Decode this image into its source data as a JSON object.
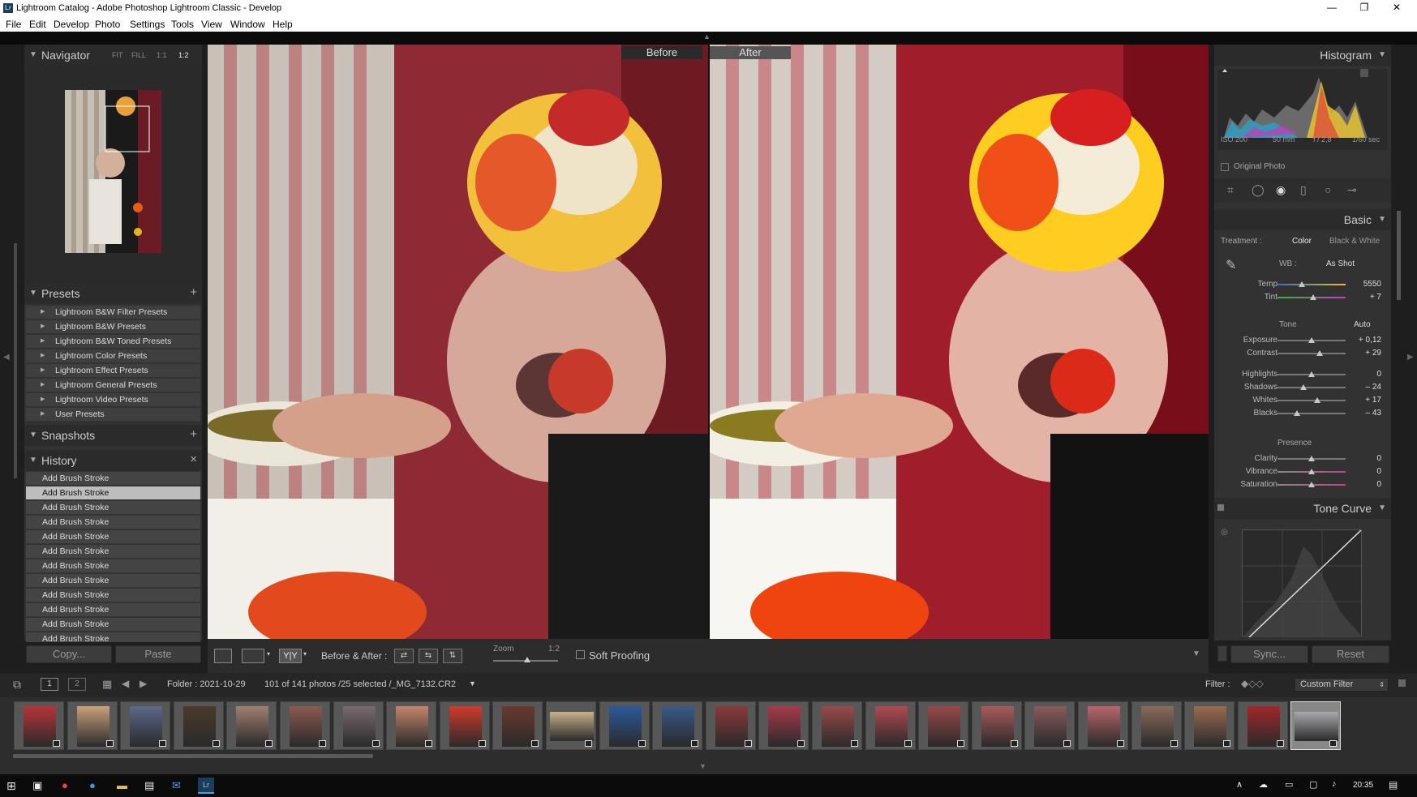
{
  "window": {
    "title": "Lightroom Catalog - Adobe Photoshop Lightroom Classic - Develop",
    "app_icon": "Lr",
    "controls": [
      "—",
      "❐",
      "✕"
    ]
  },
  "menu": [
    "File",
    "Edit",
    "Develop",
    "Photo",
    "Settings",
    "Tools",
    "View",
    "Window",
    "Help"
  ],
  "navigator": {
    "title": "Navigator",
    "options": [
      "FIT",
      "FILL",
      "1:1",
      "1:2"
    ],
    "selected": "1:2"
  },
  "presets": {
    "title": "Presets",
    "add": "+",
    "items": [
      "Lightroom B&W Filter Presets",
      "Lightroom B&W Presets",
      "Lightroom B&W Toned Presets",
      "Lightroom Color Presets",
      "Lightroom Effect Presets",
      "Lightroom General Presets",
      "Lightroom Video Presets",
      "User Presets"
    ]
  },
  "snapshots": {
    "title": "Snapshots",
    "add": "+"
  },
  "history": {
    "title": "History",
    "clear": "×",
    "items": [
      "Add Brush Stroke",
      "Add Brush Stroke",
      "Add Brush Stroke",
      "Add Brush Stroke",
      "Add Brush Stroke",
      "Add Brush Stroke",
      "Add Brush Stroke",
      "Add Brush Stroke",
      "Add Brush Stroke",
      "Add Brush Stroke",
      "Add Brush Stroke",
      "Add Brush Stroke",
      "Add Brush Stroke",
      "Add Brush Stroke"
    ],
    "selected_index": 1
  },
  "left_buttons": {
    "copy": "Copy...",
    "paste": "Paste"
  },
  "view": {
    "before_label": "Before",
    "after_label": "After"
  },
  "toolbar": {
    "before_after_label": "Before & After :",
    "zoom_label": "Zoom",
    "zoom_value": "1:2",
    "soft_proofing": "Soft Proofing"
  },
  "histogram": {
    "title": "Histogram",
    "iso": "ISO 200",
    "focal": "50 mm",
    "aperture": "f / 2,8",
    "shutter": "1/60 sec",
    "original_photo": "Original Photo"
  },
  "basic": {
    "title": "Basic",
    "treatment_label": "Treatment :",
    "treatment_color": "Color",
    "treatment_bw": "Black & White",
    "wb_label": "WB :",
    "wb_value": "As Shot",
    "temp": {
      "label": "Temp",
      "value": "5550",
      "pos": 0.36
    },
    "tint": {
      "label": "Tint",
      "value": "+ 7",
      "pos": 0.52
    },
    "tone_label": "Tone",
    "auto": "Auto",
    "exposure": {
      "label": "Exposure",
      "value": "+ 0,12",
      "pos": 0.5
    },
    "contrast": {
      "label": "Contrast",
      "value": "+ 29",
      "pos": 0.62
    },
    "highlights": {
      "label": "Highlights",
      "value": "0",
      "pos": 0.5
    },
    "shadows": {
      "label": "Shadows",
      "value": "– 24",
      "pos": 0.38
    },
    "whites": {
      "label": "Whites",
      "value": "+ 17",
      "pos": 0.58
    },
    "blacks": {
      "label": "Blacks",
      "value": "– 43",
      "pos": 0.29
    },
    "presence_label": "Presence",
    "clarity": {
      "label": "Clarity",
      "value": "0",
      "pos": 0.5
    },
    "vibrance": {
      "label": "Vibrance",
      "value": "0",
      "pos": 0.5
    },
    "saturation": {
      "label": "Saturation",
      "value": "0",
      "pos": 0.5
    }
  },
  "tone_curve": {
    "title": "Tone Curve"
  },
  "right_buttons": {
    "sync": "Sync...",
    "reset": "Reset"
  },
  "filmbar": {
    "page1": "1",
    "page2": "2",
    "folder": "Folder : 2021-10-29",
    "count": "101 of 141 photos /25 selected /_MG_7132.CR2",
    "filter_label": "Filter :",
    "filter_value": "Custom Filter"
  },
  "taskbar": {
    "time": "20:35"
  },
  "colors": {
    "panel": "#323232",
    "header": "#2b2b2b",
    "selected_history": "#bdbdbd",
    "accent_red": "#b3122a"
  }
}
